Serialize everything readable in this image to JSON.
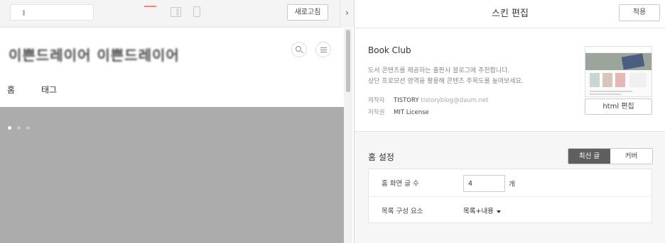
{
  "preview": {
    "refresh_label": "새로고침",
    "site_title": "이쁜드레이어 이쁜드레이어",
    "nav": [
      "홈",
      "태그"
    ]
  },
  "editor": {
    "title": "스킨 편집",
    "apply_label": "적용",
    "skin": {
      "name": "Book Club",
      "description": [
        "도서 콘텐츠를 제공하는 출판사 블로그에 추천합니다.",
        "상단 프로모션 영역을 활용해 콘텐츠 주목도를 높여보세요."
      ],
      "author_label": "제작자",
      "author_name": "TISTORY",
      "author_email": "tistoryblog@daum.net",
      "license_label": "저작권",
      "license_value": "MIT License",
      "html_edit_label": "html 편집"
    },
    "home_settings": {
      "title": "홈 설정",
      "tabs": [
        "최신 글",
        "커버"
      ],
      "active_tab": "최신 글",
      "post_count_label": "홈 화면 글 수",
      "post_count_value": "4",
      "post_count_unit": "개",
      "list_layout_label": "목록 구성 요소",
      "list_layout_value": "목록+내용"
    }
  },
  "colors": {
    "accent_tab": "#f3856e",
    "active_segment": "#5f5f5f",
    "hero_bg": "#acacac"
  }
}
